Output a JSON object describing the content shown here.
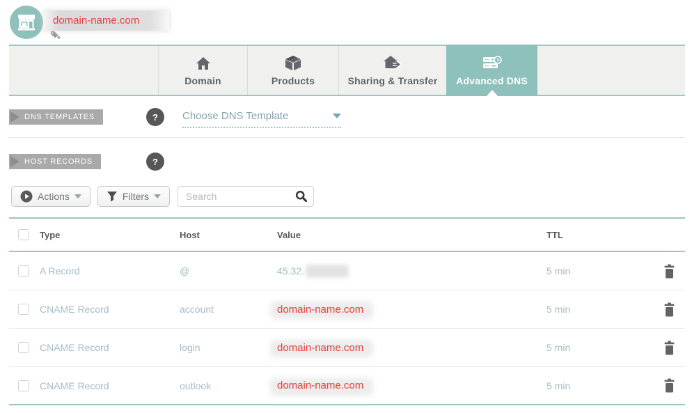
{
  "header": {
    "domain": "domain-name.com"
  },
  "tabs": [
    {
      "label": "Domain"
    },
    {
      "label": "Products"
    },
    {
      "label": "Sharing & Transfer"
    },
    {
      "label": "Advanced DNS"
    }
  ],
  "dns_templates": {
    "section_label": "DNS TEMPLATES",
    "help_label": "?",
    "dropdown_label": "Choose DNS Template"
  },
  "host_records": {
    "section_label": "HOST RECORDS",
    "help_label": "?",
    "actions_button": "Actions",
    "filters_button": "Filters",
    "search_placeholder": "Search",
    "table": {
      "columns": {
        "type": "Type",
        "host": "Host",
        "value": "Value",
        "ttl": "TTL"
      },
      "rows": [
        {
          "type": "A Record",
          "host": "@",
          "value": "45.32.",
          "ttl": "5 min"
        },
        {
          "type": "CNAME Record",
          "host": "account",
          "value": "domain-name.com",
          "ttl": "5 min"
        },
        {
          "type": "CNAME Record",
          "host": "login",
          "value": "domain-name.com",
          "ttl": "5 min"
        },
        {
          "type": "CNAME Record",
          "host": "outlook",
          "value": "domain-name.com",
          "ttl": "5 min"
        }
      ]
    }
  },
  "colors": {
    "accent_teal": "#8ec1bb",
    "teal_border": "#9cc6c1",
    "redaction_red": "#e8403b",
    "tab_background": "#f0f0ee",
    "row_text": "#a3bcc8",
    "badge_gray": "#a9a9a9"
  }
}
